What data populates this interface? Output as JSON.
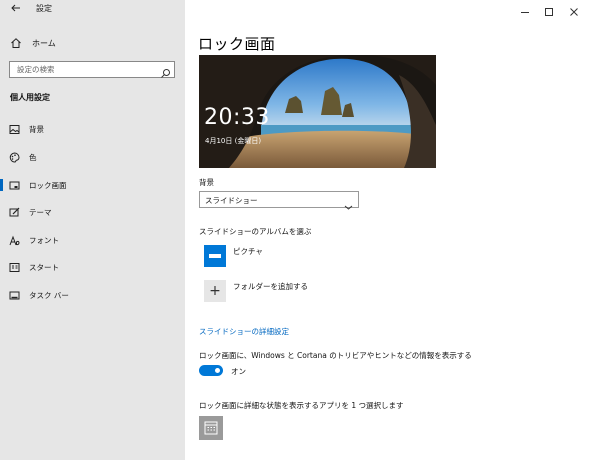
{
  "window": {
    "title": "設定"
  },
  "sidebar": {
    "home_label": "ホーム",
    "search_placeholder": "設定の検索",
    "section_title": "個人用設定",
    "items": [
      {
        "label": "背景",
        "icon": "picture-icon"
      },
      {
        "label": "色",
        "icon": "palette-icon"
      },
      {
        "label": "ロック画面",
        "icon": "lock-screen-icon",
        "active": true
      },
      {
        "label": "テーマ",
        "icon": "theme-brush-icon"
      },
      {
        "label": "フォント",
        "icon": "font-icon"
      },
      {
        "label": "スタート",
        "icon": "start-icon"
      },
      {
        "label": "タスク バー",
        "icon": "taskbar-icon"
      }
    ]
  },
  "main": {
    "title": "ロック画面",
    "preview": {
      "time": "20:33",
      "date": "4月10日 (金曜日)"
    },
    "background_label": "背景",
    "background_value": "スライドショー",
    "album_label": "スライドショーのアルバムを選ぶ",
    "album_item": "ピクチャ",
    "add_folder_label": "フォルダーを追加する",
    "advanced_link": "スライドショーの詳細設定",
    "tips_label": "ロック画面に、Windows と Cortana のトリビアやヒントなどの情報を表示する",
    "tips_toggle_state": "オン",
    "detail_app_label": "ロック画面に詳細な状態を表示するアプリを 1 つ選択します"
  },
  "colors": {
    "accent": "#0078d7",
    "link": "#0067c0",
    "sidebar_bg": "#e6e6e6"
  }
}
